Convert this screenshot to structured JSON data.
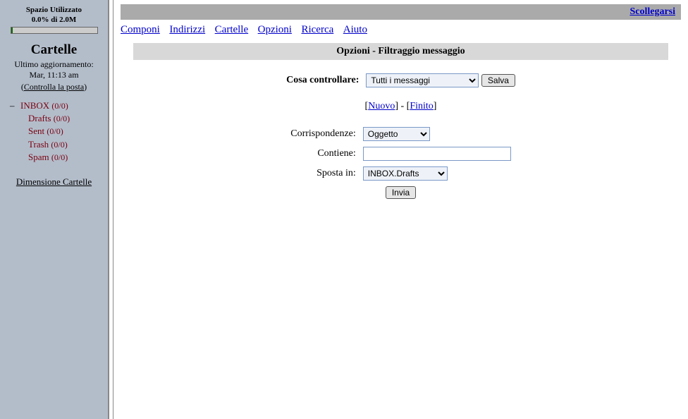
{
  "sidebar": {
    "space_heading": "Spazio Utilizzato",
    "space_value": "0.0% di 2.0M",
    "folders_title": "Cartelle",
    "last_update_1": "Ultimo aggiornamento:",
    "last_update_2": "Mar, 11:13 am",
    "check_mail": "Controlla la posta",
    "items": [
      {
        "label": "INBOX",
        "count": "(0/0)"
      },
      {
        "label": "Drafts",
        "count": "(0/0)"
      },
      {
        "label": "Sent",
        "count": "(0/0)"
      },
      {
        "label": "Trash",
        "count": "(0/0)"
      },
      {
        "label": "Spam",
        "count": "(0/0)"
      }
    ],
    "folder_sizes": "Dimensione Cartelle"
  },
  "topbar": {
    "logout": "Scollegarsi"
  },
  "menu": {
    "compose": "Componi",
    "addresses": "Indirizzi",
    "folders": "Cartelle",
    "options": "Opzioni",
    "search": "Ricerca",
    "help": "Aiuto"
  },
  "section_title": "Opzioni - Filtraggio messaggio",
  "form": {
    "what_label": "Cosa controllare:",
    "what_value": "Tutti i messaggi",
    "save": "Salva",
    "new": "Nuovo",
    "done": "Finito",
    "match_label": "Corrispondenze:",
    "match_value": "Oggetto",
    "contains_label": "Contiene:",
    "contains_value": "",
    "moveto_label": "Sposta in:",
    "moveto_value": "INBOX.Drafts",
    "submit": "Invia"
  }
}
